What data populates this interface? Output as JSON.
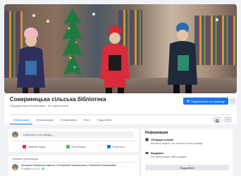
{
  "page": {
    "name": "Сокиринецька сільська бібліотека",
    "subtitle": "Общедоступна библиотека · 96 подписчиков",
    "follow_button_label": "Подписаться на страницу",
    "more_label": "···"
  },
  "tabs": [
    {
      "label": "Публикации",
      "active": true
    },
    {
      "label": "Информация",
      "active": false
    },
    {
      "label": "Упоминания",
      "active": false
    },
    {
      "label": "Фото",
      "active": false
    },
    {
      "label": "Подробнее",
      "active": false
    }
  ],
  "tabs_more_label": "···",
  "composer": {
    "placeholder": "Напишите что-нибудь...",
    "actions": [
      {
        "label": "Прямой эфир",
        "color": "#f02849"
      },
      {
        "label": "Фото/видео",
        "color": "#45bd62"
      },
      {
        "label": "Отметить",
        "color": "#1877f2"
      }
    ]
  },
  "post": {
    "header": "Свежие публикации",
    "text": "Катерина Мисюренко вместе с Катериной Чернишовою и Натальей Максимовой",
    "meta": "3 ноября в 11:24 · 🌐"
  },
  "info": {
    "title": "Информация",
    "rows": [
      {
        "icon": "info-icon",
        "strong": "Общедоступная",
        "small": "Все могут видеть, кто состоит в этой странице"
      },
      {
        "icon": "eye-icon",
        "strong": "Видимая",
        "small": "Эту группу может найти каждый"
      }
    ],
    "button_label": "Подробнее"
  },
  "colors": {
    "accent": "#1877f2",
    "background": "#f0f2f5"
  }
}
